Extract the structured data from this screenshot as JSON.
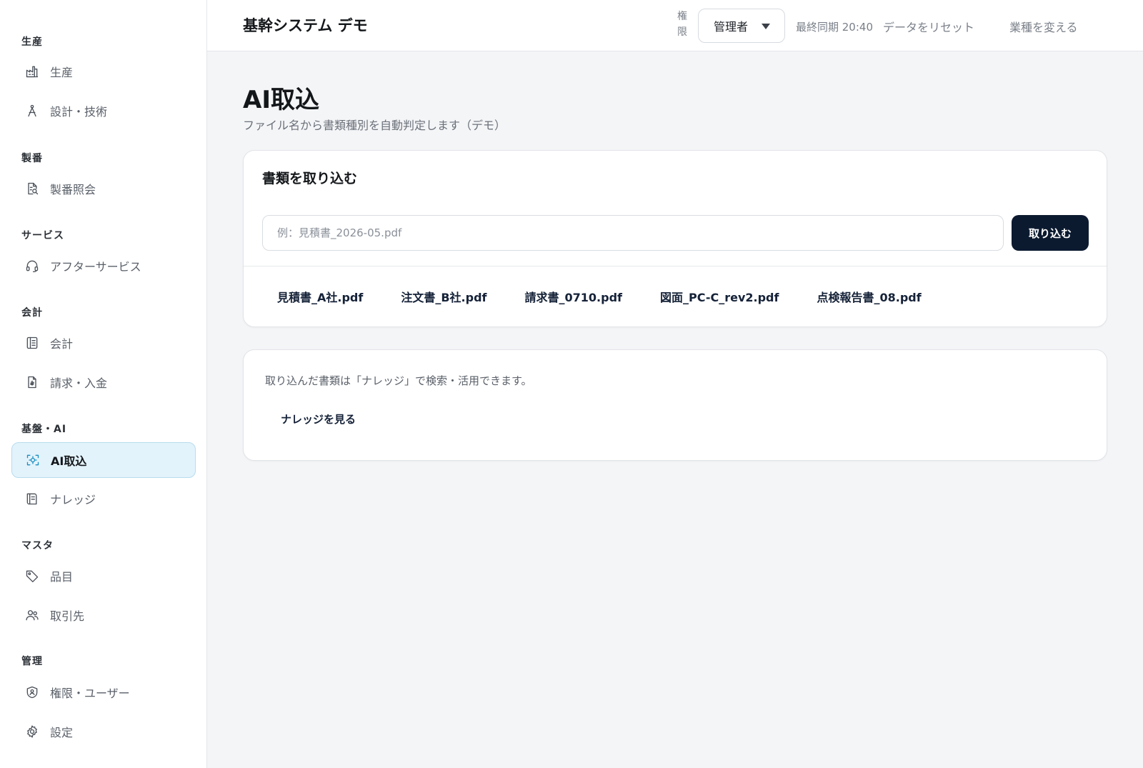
{
  "app": {
    "title": "基幹システム デモ"
  },
  "topbar": {
    "role_label": "権限",
    "role_value": "管理者",
    "last_sync": "最終同期 20:40",
    "reset_data": "データをリセット",
    "change_industry": "業種を変える"
  },
  "sidebar": {
    "groups": [
      {
        "label": "生産"
      },
      {
        "label": "製番"
      },
      {
        "label": "サービス"
      },
      {
        "label": "会計"
      },
      {
        "label": "基盤・AI"
      },
      {
        "label": "マスタ"
      },
      {
        "label": "管理"
      }
    ],
    "items": [
      {
        "label": "生産",
        "icon": "factory-icon"
      },
      {
        "label": "設計・技術",
        "icon": "compass-icon"
      },
      {
        "label": "製番照会",
        "icon": "document-search-icon"
      },
      {
        "label": "アフターサービス",
        "icon": "headset-icon"
      },
      {
        "label": "会計",
        "icon": "ledger-icon"
      },
      {
        "label": "請求・入金",
        "icon": "invoice-icon"
      },
      {
        "label": "AI取込",
        "icon": "scan-icon",
        "active": true
      },
      {
        "label": "ナレッジ",
        "icon": "book-icon"
      },
      {
        "label": "品目",
        "icon": "tag-icon"
      },
      {
        "label": "取引先",
        "icon": "users-icon"
      },
      {
        "label": "権限・ユーザー",
        "icon": "shield-icon"
      },
      {
        "label": "設定",
        "icon": "gear-icon"
      }
    ]
  },
  "page": {
    "title": "AI取込",
    "subtitle": "ファイル名から書類種別を自動判定します（デモ）"
  },
  "import_card": {
    "title": "書類を取り込む",
    "placeholder": "例：見積書_2026-05.pdf",
    "value": "",
    "button": "取り込む",
    "samples": [
      "見積書_A社.pdf",
      "注文書_B社.pdf",
      "請求書_0710.pdf",
      "図面_PC-C_rev2.pdf",
      "点検報告書_08.pdf"
    ]
  },
  "knowledge_card": {
    "note": "取り込んだ書類は「ナレッジ」で検索・活用できます。",
    "link": "ナレッジを見る"
  },
  "colors": {
    "primary": "#0c1a30",
    "active_bg": "#e3f3fb",
    "active_border": "#b7dced",
    "active_icon": "#1c8fc4",
    "page_bg": "#f4f5f7"
  }
}
